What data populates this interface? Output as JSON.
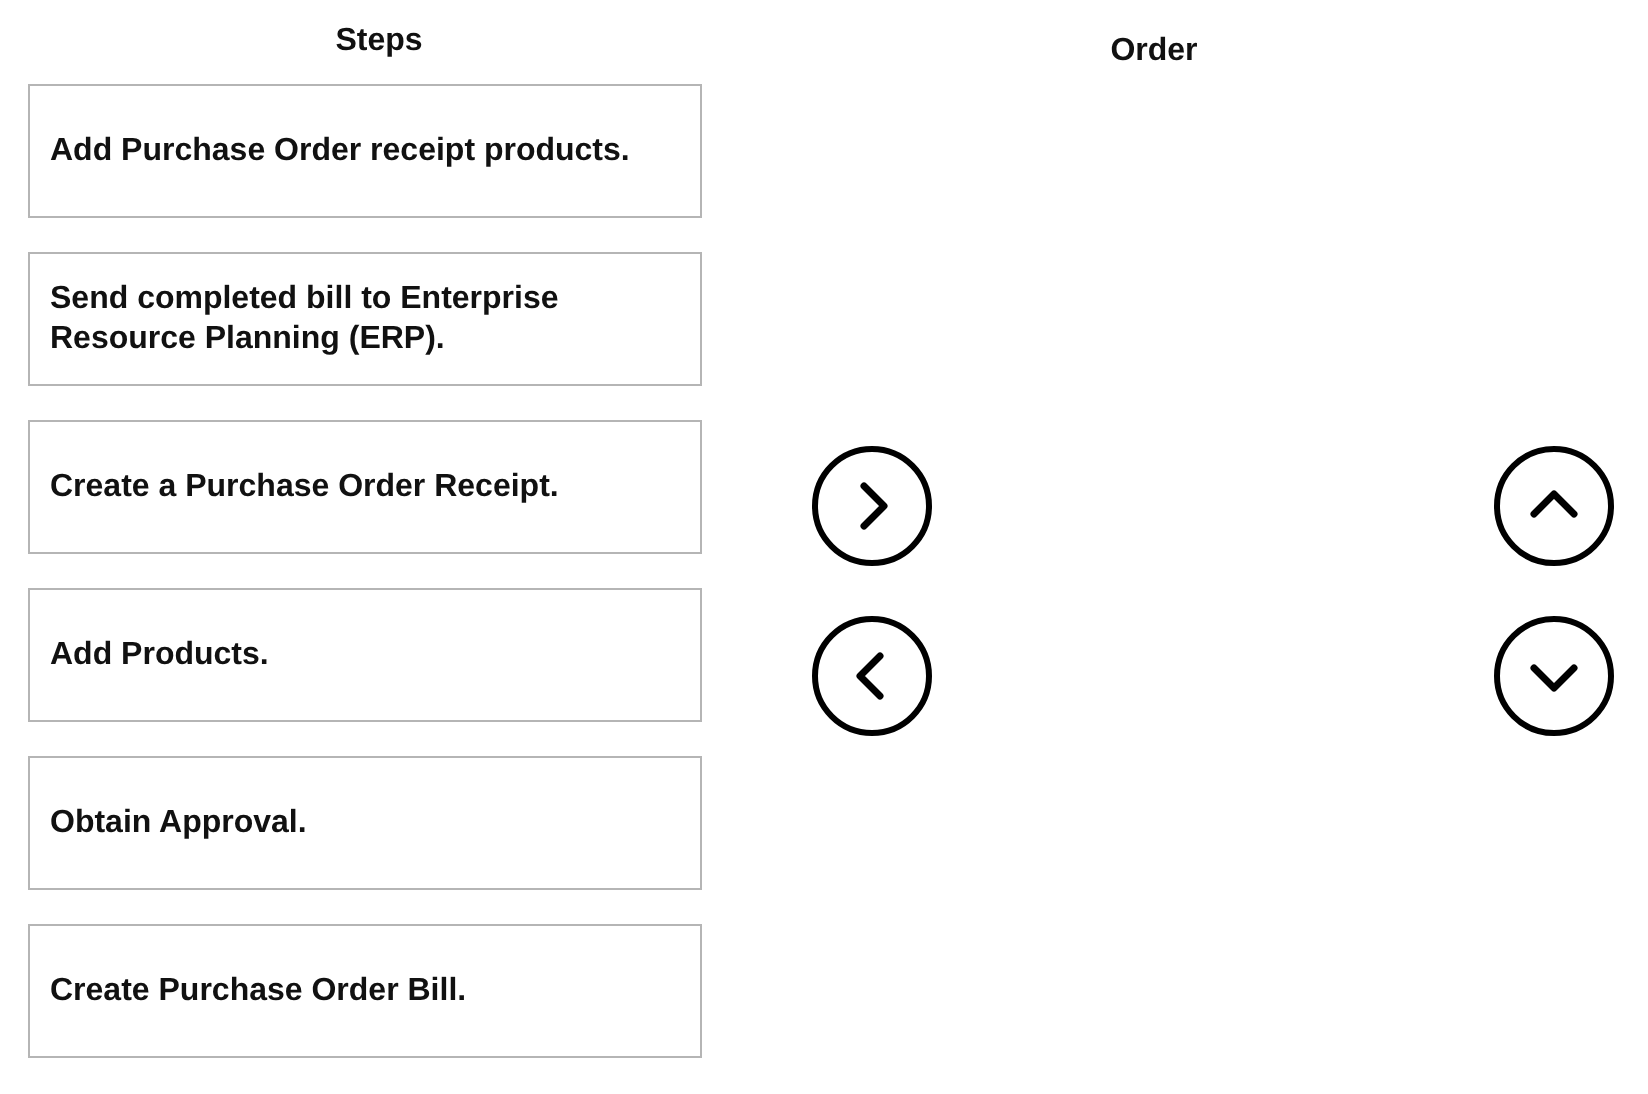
{
  "steps_panel": {
    "heading": "Steps",
    "items": [
      {
        "text": "Add Purchase Order receipt products."
      },
      {
        "text": "Send completed bill to Enterprise Resource Planning (ERP)."
      },
      {
        "text": "Create a Purchase Order Receipt."
      },
      {
        "text": "Add Products."
      },
      {
        "text": "Obtain Approval."
      },
      {
        "text": "Create Purchase Order Bill."
      }
    ]
  },
  "move_buttons": [
    {
      "kind": "right"
    },
    {
      "kind": "left"
    }
  ],
  "order_panel": {
    "heading": "Order"
  },
  "reorder_buttons": [
    {
      "kind": "up"
    },
    {
      "kind": "down"
    }
  ]
}
